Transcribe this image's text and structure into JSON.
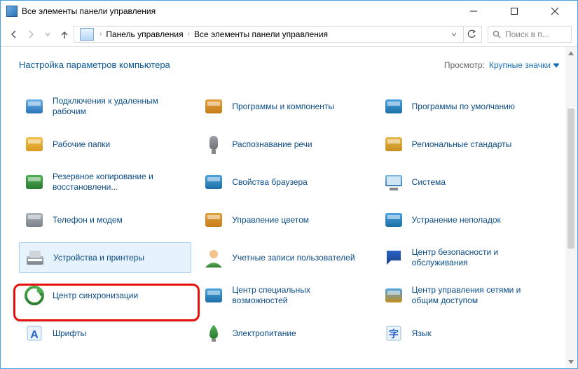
{
  "window": {
    "title": "Все элементы панели управления"
  },
  "breadcrumb": {
    "seg1": "Панель управления",
    "seg2": "Все элементы панели управления"
  },
  "search": {
    "placeholder": "Поиск в п..."
  },
  "heading": "Настройка параметров компьютера",
  "view": {
    "label": "Просмотр:",
    "value": "Крупные значки"
  },
  "items": [
    {
      "label": "Подключения к удаленным рабочим"
    },
    {
      "label": "Программы и компоненты"
    },
    {
      "label": "Программы по умолчанию"
    },
    {
      "label": "Рабочие папки"
    },
    {
      "label": "Распознавание речи"
    },
    {
      "label": "Региональные стандарты"
    },
    {
      "label": "Резервное копирование и восстановлени..."
    },
    {
      "label": "Свойства браузера"
    },
    {
      "label": "Система"
    },
    {
      "label": "Телефон и модем"
    },
    {
      "label": "Управление цветом"
    },
    {
      "label": "Устранение неполадок"
    },
    {
      "label": "Устройства и принтеры"
    },
    {
      "label": "Учетные записи пользователей"
    },
    {
      "label": "Центр безопасности и обслуживания"
    },
    {
      "label": "Центр синхронизации"
    },
    {
      "label": "Центр специальных возможностей"
    },
    {
      "label": "Центр управления сетями и общим доступом"
    },
    {
      "label": "Шрифты"
    },
    {
      "label": "Электропитание"
    },
    {
      "label": "Язык"
    }
  ],
  "icon_colors": {
    "c0": [
      "#6ab1e6",
      "#2a73b8"
    ],
    "c1": [
      "#e0a03a",
      "#c67e1b"
    ],
    "c2": [
      "#4aa3df",
      "#1d6fa5"
    ],
    "c3": [
      "#f2c04a",
      "#d79a1f"
    ],
    "c4": [
      "#9aa0a6",
      "#6b7177"
    ],
    "c5": [
      "#e6b84c",
      "#c78f1f"
    ],
    "c6": [
      "#4cb050",
      "#2d7a31"
    ],
    "c7": [
      "#4aa3df",
      "#1d6fa5"
    ],
    "c8": [
      "#7fb7e4",
      "#3d7cb3"
    ],
    "c9": [
      "#b0b6bc",
      "#7a8188"
    ],
    "c10": [
      "#e0a03a",
      "#c67e1b"
    ],
    "c11": [
      "#4aa3df",
      "#1d6fa5"
    ],
    "c12": [
      "#b0b6bc",
      "#7a8188"
    ],
    "c13": [
      "#5eb05e",
      "#2f7a2f"
    ],
    "c14": [
      "#2a62c6",
      "#1a3e80"
    ],
    "c15": [
      "#4cb050",
      "#2d7a31"
    ],
    "c16": [
      "#4aa3df",
      "#1d6fa5"
    ],
    "c17": [
      "#4aa3df",
      "#c78f1f"
    ],
    "c18": [
      "#2a62c6",
      "#e3b23a"
    ],
    "c19": [
      "#4cb050",
      "#2d7a31"
    ],
    "c20": [
      "#2a62c6",
      "#1a3e80"
    ]
  }
}
